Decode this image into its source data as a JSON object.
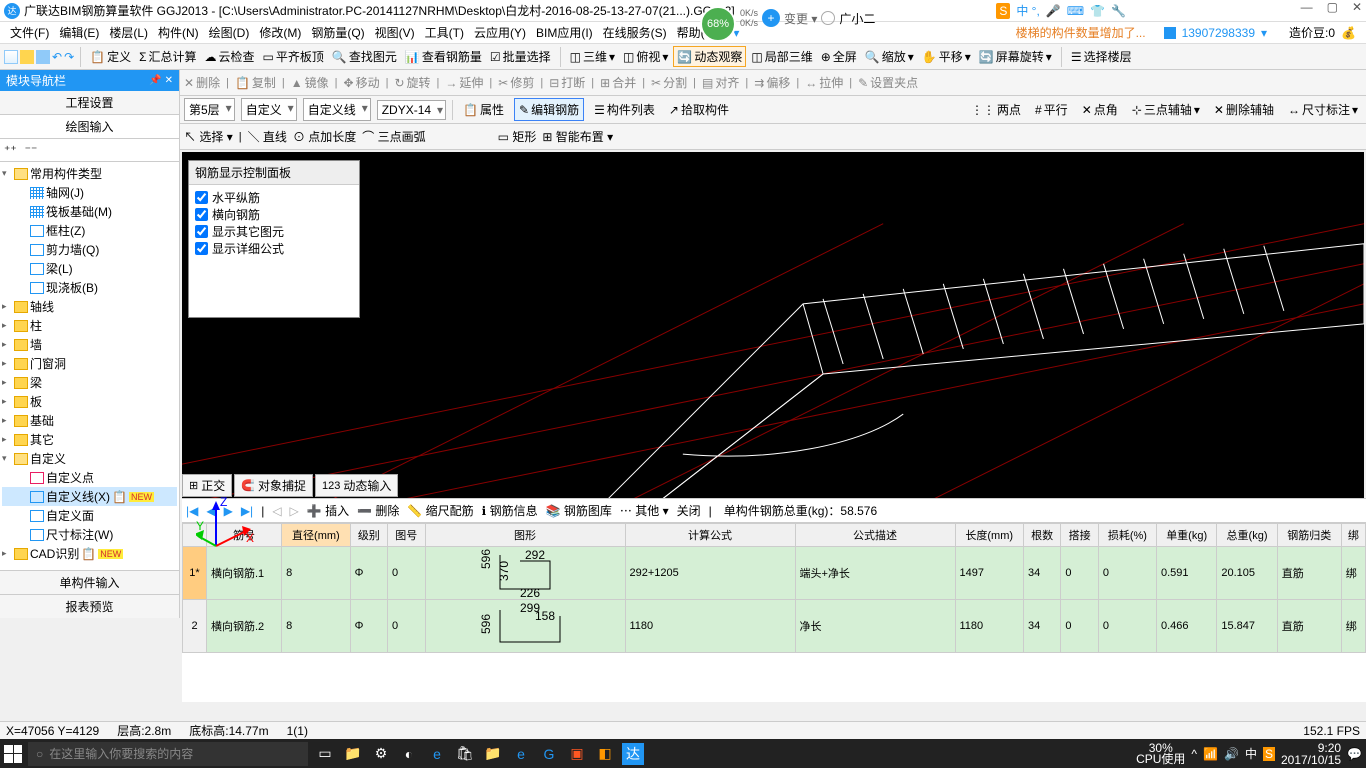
{
  "title": "广联达BIM钢筋算量软件 GGJ2013 - [C:\\Users\\Administrator.PC-20141127NRHM\\Desktop\\白龙村-2016-08-25-13-27-07(21...).GGJ12]",
  "pct": "68%",
  "speed_up": "0K/s",
  "speed_dn": "0K/s",
  "change": "变更 ▾",
  "username": "广小二",
  "notice": "楼梯的构件数量增加了...",
  "phone": "13907298339",
  "beans_label": "造价豆:0",
  "menu": [
    "文件(F)",
    "编辑(E)",
    "楼层(L)",
    "构件(N)",
    "绘图(D)",
    "修改(M)",
    "钢筋量(Q)",
    "视图(V)",
    "工具(T)",
    "云应用(Y)",
    "BIM应用(I)",
    "在线服务(S)",
    "帮助(H)"
  ],
  "tb1": {
    "define": "定义",
    "sum": "汇总计算",
    "cloud": "云检查",
    "plat": "平齐板顶",
    "find": "查找图元",
    "rebar": "查看钢筋量",
    "batch": "批量选择",
    "v3d": "三维",
    "top": "俯视",
    "dyn": "动态观察",
    "local": "局部三维",
    "full": "全屏",
    "zoom": "缩放",
    "pan": "平移",
    "rot": "屏幕旋转",
    "layer": "选择楼层"
  },
  "tb2": {
    "del": "删除",
    "copy": "复制",
    "mirror": "镜像",
    "move": "移动",
    "rotate": "旋转",
    "extend": "延伸",
    "trim": "修剪",
    "break": "打断",
    "merge": "合并",
    "split": "分割",
    "align": "对齐",
    "offset": "偏移",
    "stretch": "拉伸",
    "setpt": "设置夹点"
  },
  "tb3": {
    "floor": "第5层",
    "cat": "自定义",
    "sub": "自定义线",
    "code": "ZDYX-14",
    "prop": "属性",
    "edit": "编辑钢筋",
    "list": "构件列表",
    "pick": "拾取构件",
    "p2": "两点",
    "para": "平行",
    "ang": "点角",
    "ax3": "三点辅轴",
    "delax": "删除辅轴",
    "dim": "尺寸标注"
  },
  "tb4": {
    "sel": "选择",
    "line": "直线",
    "addlen": "点加长度",
    "arc3": "三点画弧",
    "rect": "矩形",
    "smart": "智能布置"
  },
  "sidebar": {
    "title": "模块导航栏",
    "tab1": "工程设置",
    "tab2": "绘图输入",
    "bottom1": "单构件输入",
    "bottom2": "报表预览"
  },
  "tree": {
    "root": "常用构件类型",
    "axisnet": "轴网(J)",
    "raft": "筏板基础(M)",
    "fcol": "框柱(Z)",
    "swall": "剪力墙(Q)",
    "beam": "梁(L)",
    "slab": "现浇板(B)",
    "axis": "轴线",
    "col": "柱",
    "wall": "墙",
    "opening": "门窗洞",
    "beam2": "梁",
    "slab2": "板",
    "found": "基础",
    "other": "其它",
    "custom": "自定义",
    "cpt": "自定义点",
    "cline": "自定义线(X)",
    "cface": "自定义面",
    "cdim": "尺寸标注(W)",
    "cad": "CAD识别"
  },
  "panel": {
    "title": "钢筋显示控制面板",
    "items": [
      "水平纵筋",
      "横向钢筋",
      "显示其它图元",
      "显示详细公式"
    ]
  },
  "btabs": {
    "ortho": "正交",
    "snap": "对象捕捉",
    "dyn": "动态输入"
  },
  "gridtb": {
    "ins": "插入",
    "del": "删除",
    "scale": "缩尺配筋",
    "info": "钢筋信息",
    "lib": "钢筋图库",
    "other": "其他",
    "close": "关闭",
    "weight_label": "单构件钢筋总重(kg)：",
    "weight": "58.576"
  },
  "cols": [
    "筋号",
    "直径(mm)",
    "级别",
    "图号",
    "图形",
    "计算公式",
    "公式描述",
    "长度(mm)",
    "根数",
    "搭接",
    "损耗(%)",
    "单重(kg)",
    "总重(kg)",
    "钢筋归类",
    "绑"
  ],
  "rows": [
    {
      "n": "1*",
      "name": "横向钢筋.1",
      "dia": "8",
      "lvl": "Φ",
      "no": "0",
      "formula": "292+1205",
      "desc": "端头+净长",
      "len": "1497",
      "cnt": "34",
      "lap": "0",
      "loss": "0",
      "uw": "0.591",
      "tw": "20.105",
      "cat": "直筋",
      "b": "绑",
      "s1": "596",
      "s2": "370",
      "s3": "292",
      "s4": "226"
    },
    {
      "n": "2",
      "name": "横向钢筋.2",
      "dia": "8",
      "lvl": "Φ",
      "no": "0",
      "formula": "1180",
      "desc": "净长",
      "len": "1180",
      "cnt": "34",
      "lap": "0",
      "loss": "0",
      "uw": "0.466",
      "tw": "15.847",
      "cat": "直筋",
      "b": "绑",
      "s1": "596",
      "s3": "299",
      "s5": "158"
    }
  ],
  "status": {
    "xy": "X=47056 Y=4129",
    "fh": "层高:2.8m",
    "bh": "底标高:14.77m",
    "sel": "1(1)",
    "fps": "152.1 FPS"
  },
  "taskbar": {
    "search": "在这里输入你要搜索的内容",
    "cpu": "30%",
    "cpu_lbl": "CPU使用",
    "time": "9:20",
    "date": "2017/10/15"
  }
}
